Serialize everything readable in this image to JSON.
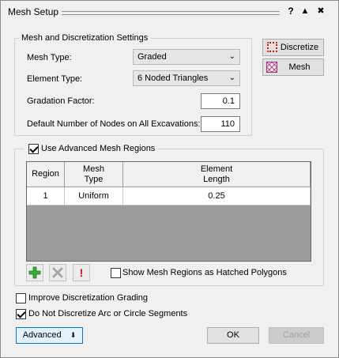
{
  "window": {
    "title": "Mesh Setup",
    "help": "?",
    "up": "▲",
    "close": "✖"
  },
  "settings": {
    "group_title": "Mesh and Discretization Settings",
    "mesh_type_label": "Mesh Type:",
    "mesh_type_value": "Graded",
    "element_type_label": "Element Type:",
    "element_type_value": "6 Noded Triangles",
    "gradation_label": "Gradation Factor:",
    "gradation_value": "0.1",
    "nodes_label": "Default Number of Nodes on All Excavations:",
    "nodes_value": "110"
  },
  "side_buttons": {
    "discretize": "Discretize",
    "mesh": "Mesh"
  },
  "regions": {
    "checkbox_label": "Use Advanced Mesh Regions",
    "checked": true,
    "headers": {
      "region": "Region",
      "mesh_type": "Mesh Type",
      "element_length": "Element Length"
    },
    "rows": [
      {
        "region": "1",
        "mesh_type": "Uniform",
        "element_length": "0.25"
      }
    ],
    "show_hatched_label": "Show Mesh Regions as Hatched Polygons",
    "show_hatched_checked": false,
    "tool_icons": {
      "add": "add-icon",
      "delete": "delete-icon",
      "warning": "exclamation-icon"
    }
  },
  "options": {
    "improve_label": "Improve Discretization Grading",
    "improve_checked": false,
    "no_discretize_label": "Do Not Discretize Arc or Circle Segments",
    "no_discretize_checked": true
  },
  "footer": {
    "advanced": "Advanced",
    "ok": "OK",
    "cancel": "Cancel"
  },
  "colors": {
    "accent_blue": "#0078d7",
    "add_green": "#2e9e2e",
    "warning_red": "#d01010",
    "table_gray": "#9c9c9c"
  }
}
